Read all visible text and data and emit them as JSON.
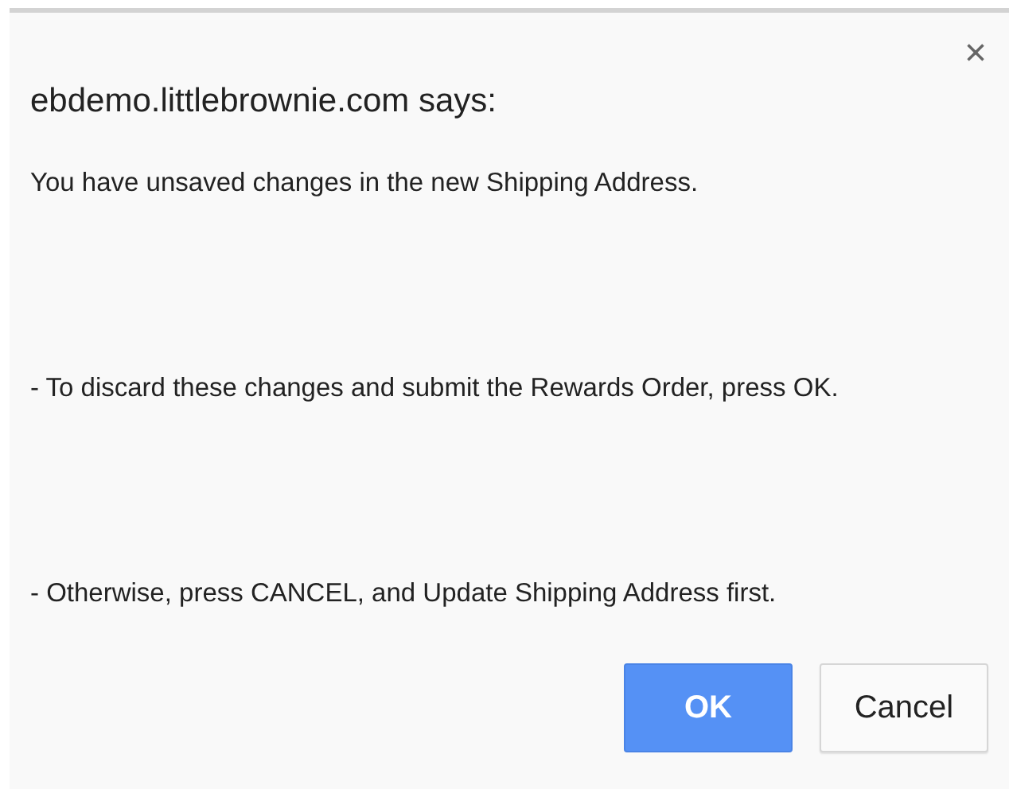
{
  "dialog": {
    "title": "ebdemo.littlebrownie.com says:",
    "close": "×",
    "message": [
      "You have unsaved changes in the new Shipping Address.",
      "- To discard these changes and submit the Rewards Order, press OK.",
      "- Otherwise, press CANCEL, and Update Shipping Address first."
    ],
    "buttons": [
      {
        "label": "OK",
        "kind": "primary"
      },
      {
        "label": "Cancel",
        "kind": "default"
      }
    ]
  }
}
